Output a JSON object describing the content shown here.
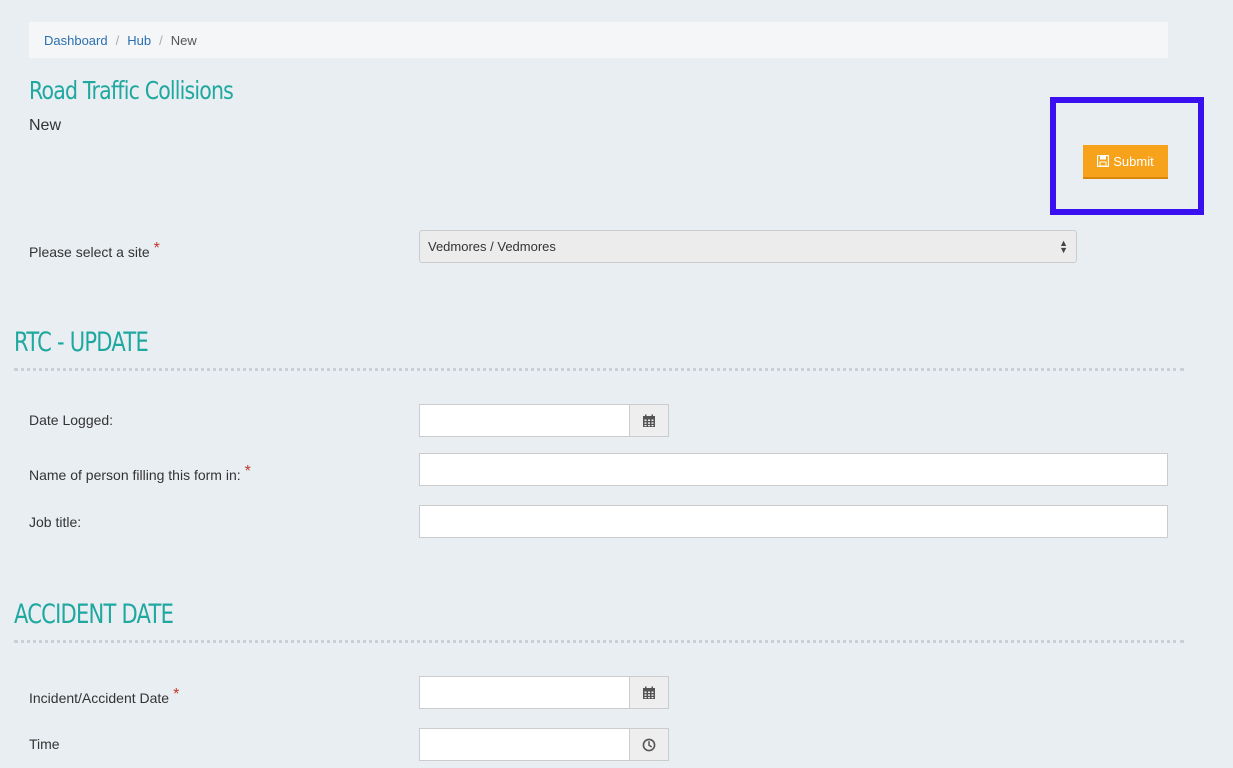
{
  "breadcrumb": {
    "items": [
      "Dashboard",
      "Hub"
    ],
    "current": "New",
    "separator": "/"
  },
  "page": {
    "title": "Road Traffic Collisions",
    "subtitle": "New"
  },
  "actions": {
    "submit_label": "Submit",
    "submit_color": "#f7a21b",
    "highlight_color": "#3a10f0"
  },
  "site": {
    "label": "Please select a site",
    "required_mark": "*",
    "value": "Vedmores / Vedmores"
  },
  "sections": [
    {
      "title": "RTC - UPDATE",
      "fields": [
        {
          "label": "Date Logged:",
          "value": "",
          "icon": "calendar-icon"
        },
        {
          "label": "Name of person filling this form in:",
          "required_mark": "*",
          "value": ""
        },
        {
          "label": "Job title:",
          "value": ""
        }
      ]
    },
    {
      "title": "ACCIDENT DATE",
      "fields": [
        {
          "label": "Incident/Accident Date",
          "required_mark": "*",
          "value": "",
          "icon": "calendar-icon"
        },
        {
          "label": "Time",
          "value": "",
          "icon": "clock-icon"
        }
      ]
    }
  ],
  "colors": {
    "accent": "#1fa8a0",
    "background": "#e9eef2",
    "link": "#2a6fb0"
  }
}
